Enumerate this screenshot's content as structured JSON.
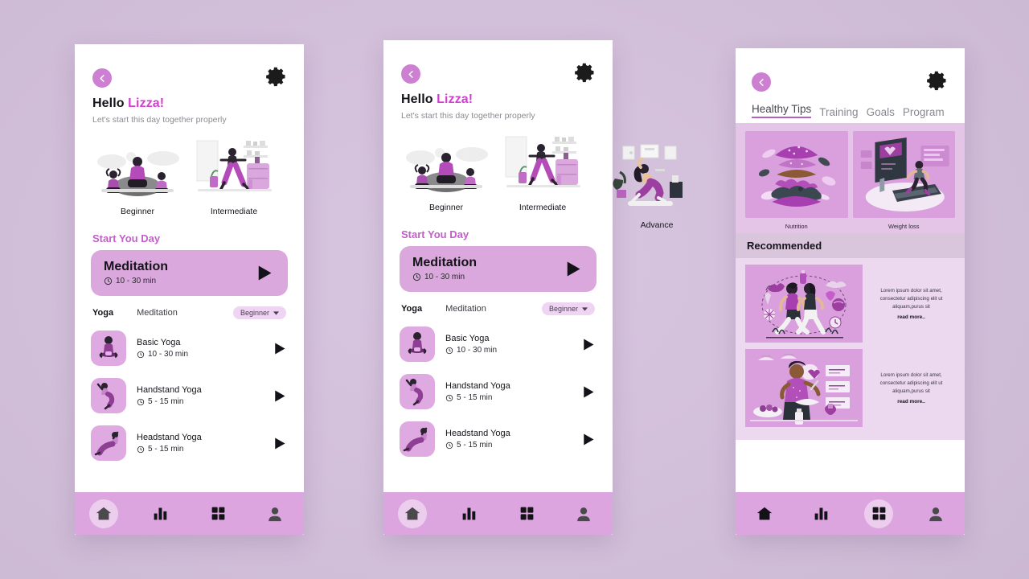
{
  "background": {
    "color": "#d2bfd9"
  },
  "theme": {
    "accent": "#c25fc8",
    "accent_strong": "#d23fd0",
    "card": "#dba8de",
    "nav": "#dda5e0"
  },
  "phone1": {
    "greeting": "Hello",
    "name": "Lizza!",
    "subtitle": "Let's start this day together properly",
    "levels": [
      {
        "label": "Beginner"
      },
      {
        "label": "Intermediate"
      }
    ],
    "section_title": "Start You Day",
    "meditation": {
      "title": "Meditation",
      "duration": "10 - 30 min"
    },
    "tabs": {
      "active": "Yoga",
      "inactive": "Meditation",
      "filter": "Beginner"
    },
    "workouts": [
      {
        "name": "Basic Yoga",
        "duration": "10 - 30 min"
      },
      {
        "name": "Handstand Yoga",
        "duration": "5 - 15 min"
      },
      {
        "name": "Headstand Yoga",
        "duration": "5 - 15 min"
      }
    ],
    "nav": [
      {
        "icon": "home-icon",
        "active": true
      },
      {
        "icon": "stats-icon",
        "active": false
      },
      {
        "icon": "grid-icon",
        "active": false
      },
      {
        "icon": "profile-icon",
        "active": false
      }
    ]
  },
  "phone2": {
    "greeting": "Hello",
    "name": "Lizza!",
    "subtitle": "Let's start this day together properly",
    "levels": [
      {
        "label": "Beginner"
      },
      {
        "label": "Intermediate"
      }
    ],
    "overflow_level": {
      "label": "Advance"
    },
    "section_title": "Start You Day",
    "meditation": {
      "title": "Meditation",
      "duration": "10 - 30 min"
    },
    "tabs": {
      "active": "Yoga",
      "inactive": "Meditation",
      "filter": "Beginner"
    },
    "workouts": [
      {
        "name": "Basic Yoga",
        "duration": "10 - 30 min"
      },
      {
        "name": "Handstand Yoga",
        "duration": "5 - 15 min"
      },
      {
        "name": "Headstand Yoga",
        "duration": "5 - 15 min"
      }
    ],
    "nav": [
      {
        "icon": "home-icon",
        "active": true
      },
      {
        "icon": "stats-icon",
        "active": false
      },
      {
        "icon": "grid-icon",
        "active": false
      },
      {
        "icon": "profile-icon",
        "active": false
      }
    ]
  },
  "phone3": {
    "tabs": [
      {
        "label": "Healthy Tips",
        "active": true
      },
      {
        "label": "Training",
        "active": false
      },
      {
        "label": "Goals",
        "active": false
      },
      {
        "label": "Program",
        "active": false
      }
    ],
    "top_cards": [
      {
        "caption": "Nutrition"
      },
      {
        "caption": "Weight loss"
      }
    ],
    "recommended_title": "Recommended",
    "recommended": [
      {
        "body": "Lorem ipsum dolor sit amet, consectetur adipiscing elit ut aliquam,purus sit",
        "link": "read more.."
      },
      {
        "body": "Lorem ipsum dolor sit amet, consectetur adipiscing elit ut aliquam,purus sit",
        "link": "read more.."
      }
    ],
    "nav": [
      {
        "icon": "home-icon",
        "active": false
      },
      {
        "icon": "stats-icon",
        "active": false
      },
      {
        "icon": "grid-icon",
        "active": true
      },
      {
        "icon": "profile-icon",
        "active": false
      }
    ]
  }
}
